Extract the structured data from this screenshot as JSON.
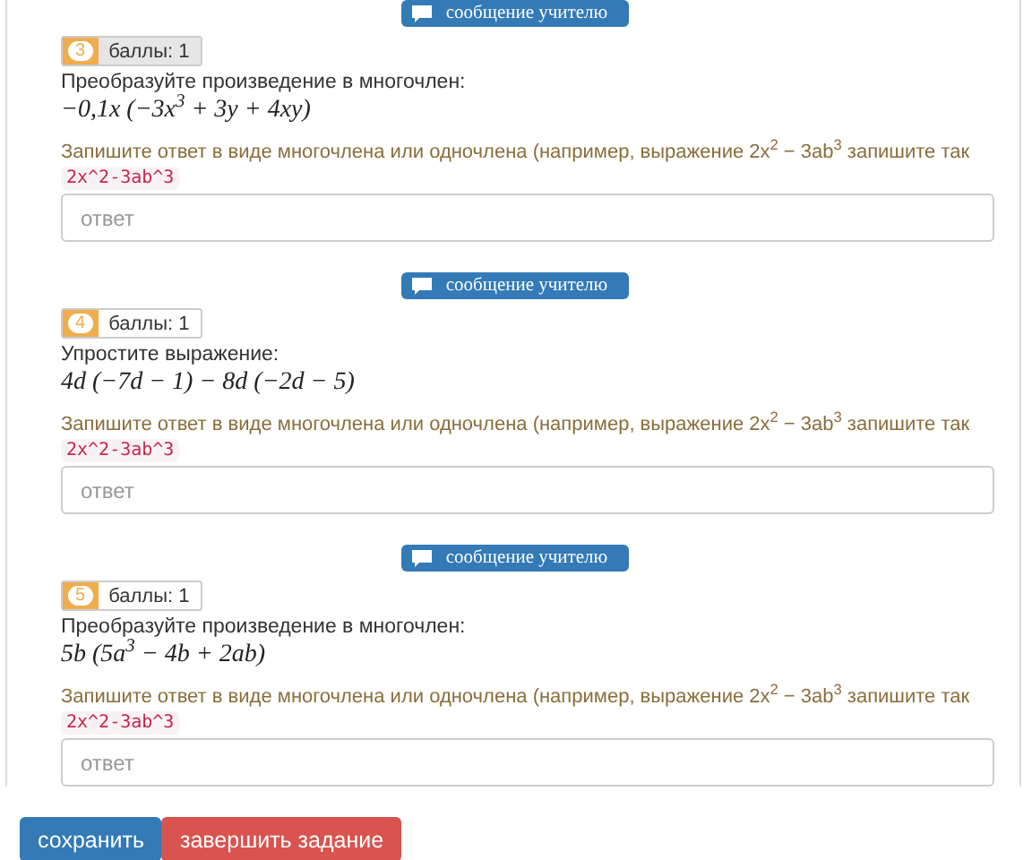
{
  "tasks": [
    {
      "message_button": "сообщение учителю",
      "number": "3",
      "points": "баллы: 1",
      "points_shaded": true,
      "prompt": "Преобразуйте произведение в многочлен:",
      "expression": "−0,1x (−3x$^{3}$ + 3y + 4xy)",
      "hint": "Запишите ответ в виде многочлена или одночлена (например, выражение 2x$^{2}$ − 3ab$^{3}$ запишите так",
      "example": "2x^2-3ab^3",
      "placeholder": "ответ"
    },
    {
      "message_button": "сообщение учителю",
      "number": "4",
      "points": "баллы: 1",
      "points_shaded": false,
      "prompt": "Упростите выражение:",
      "expression": "4d (−7d − 1) − 8d (−2d − 5)",
      "hint": "Запишите ответ в виде многочлена или одночлена (например, выражение 2x$^{2}$ − 3ab$^{3}$ запишите так",
      "example": "2x^2-3ab^3",
      "placeholder": "ответ"
    },
    {
      "message_button": "сообщение учителю",
      "number": "5",
      "points": "баллы: 1",
      "points_shaded": false,
      "prompt": "Преобразуйте произведение в многочлен:",
      "expression": "5b (5a$^{3}$ − 4b + 2ab)",
      "hint": "Запишите ответ в виде многочлена или одночлена (например, выражение 2x$^{2}$ − 3ab$^{3}$ запишите так",
      "example": "2x^2-3ab^3",
      "placeholder": "ответ"
    }
  ],
  "actions": [
    {
      "label": "сохранить",
      "kind": "primary"
    },
    {
      "label": "завершить задание",
      "kind": "danger"
    }
  ]
}
